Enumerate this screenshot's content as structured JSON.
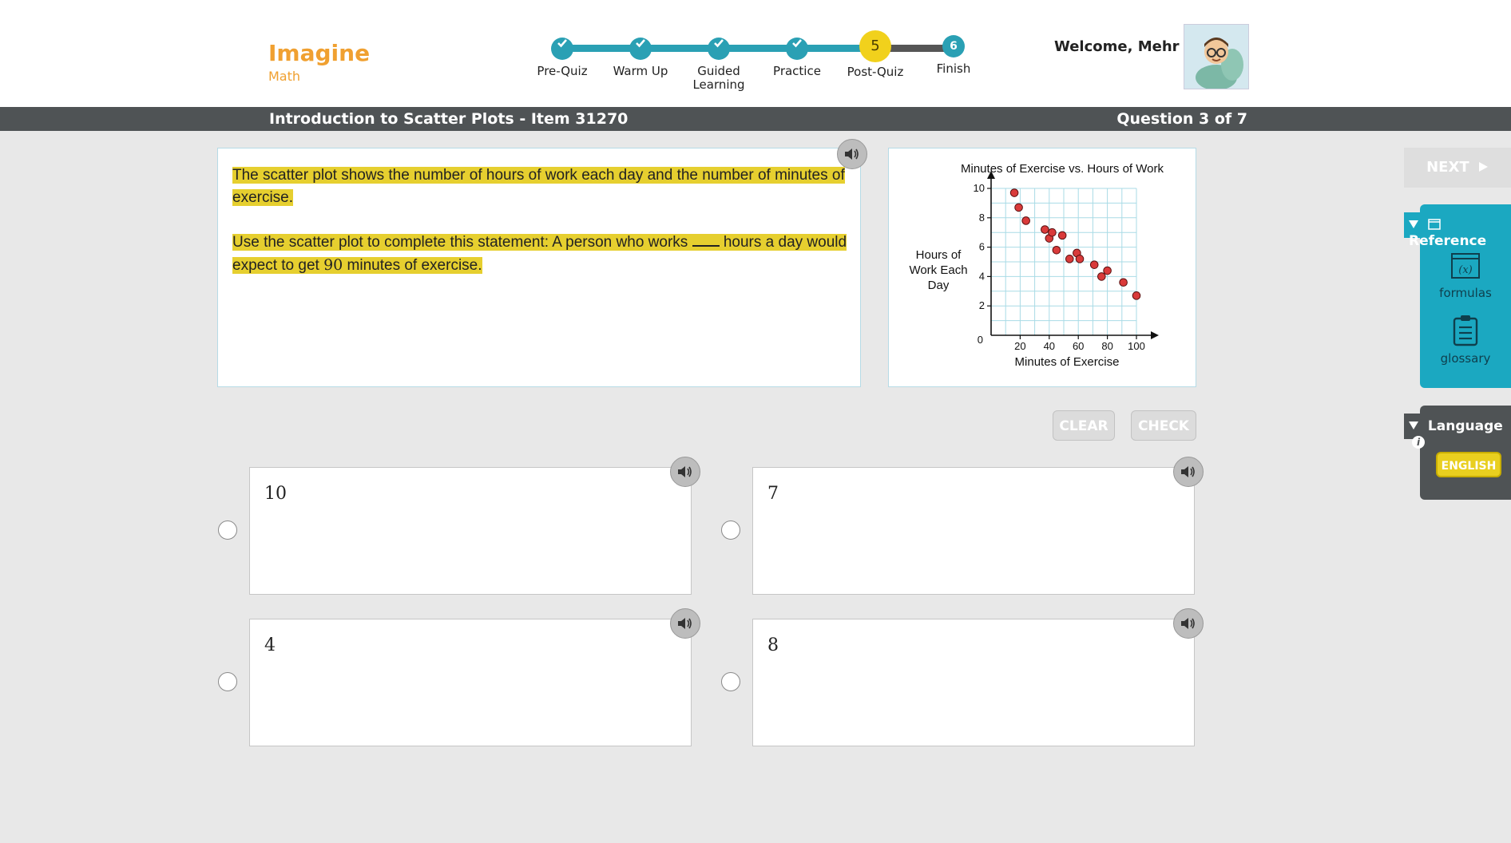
{
  "header": {
    "logo_main": "Imagine",
    "logo_sub": "Math",
    "steps": [
      {
        "label": "Pre-Quiz",
        "state": "done"
      },
      {
        "label": "Warm Up",
        "state": "done"
      },
      {
        "label": "Guided Learning",
        "state": "done"
      },
      {
        "label": "Practice",
        "state": "done"
      },
      {
        "label": "Post-Quiz",
        "state": "current",
        "number": "5"
      },
      {
        "label": "Finish",
        "state": "todo",
        "number": "6"
      }
    ],
    "welcome": "Welcome, Mehr"
  },
  "titlebar": {
    "title": "Introduction to Scatter Plots - Item 31270",
    "question_count": "Question 3 of 7"
  },
  "prompt": {
    "paragraph1": "The scatter plot shows the number of hours of work each day and the number of minutes of exercise.",
    "paragraph2_before": "Use the scatter plot to complete this statement: A person who works",
    "paragraph2_mid": "hours a day would expect to get",
    "paragraph2_value": "90",
    "paragraph2_after": "minutes of exercise."
  },
  "chart_data": {
    "type": "scatter",
    "title": "Minutes of Exercise vs. Hours of Work",
    "xlabel": "Minutes of Exercise",
    "ylabel": "Hours of Work Each Day",
    "xlim": [
      0,
      100
    ],
    "ylim": [
      0,
      10
    ],
    "x_ticks": [
      20,
      40,
      60,
      80,
      100
    ],
    "y_ticks": [
      2,
      4,
      6,
      8,
      10
    ],
    "origin_label": "0",
    "grid": true,
    "point_color": "#d93a3a",
    "points": [
      [
        16,
        9.7
      ],
      [
        19,
        8.7
      ],
      [
        24,
        7.8
      ],
      [
        37,
        7.2
      ],
      [
        40,
        6.6
      ],
      [
        42,
        7.0
      ],
      [
        45,
        5.8
      ],
      [
        49,
        6.8
      ],
      [
        54,
        5.2
      ],
      [
        59,
        5.6
      ],
      [
        61,
        5.2
      ],
      [
        71,
        4.8
      ],
      [
        76,
        4.0
      ],
      [
        80,
        4.4
      ],
      [
        91,
        3.6
      ],
      [
        100,
        2.7
      ]
    ]
  },
  "controls": {
    "clear_label": "CLEAR",
    "check_label": "CHECK"
  },
  "choices": [
    {
      "value": "10"
    },
    {
      "value": "7"
    },
    {
      "value": "4"
    },
    {
      "value": "8"
    }
  ],
  "sidebar": {
    "next_label": "NEXT",
    "reference_label": "Reference",
    "formulas_label": "formulas",
    "glossary_label": "glossary",
    "language_label": "Language",
    "english_label": "ENGLISH"
  },
  "colors": {
    "accent_teal": "#2aa0b4",
    "current_step_yellow": "#f1d11c",
    "highlight_yellow": "#e6cf2f",
    "reference_panel": "#1ba8c1",
    "dark_bar": "#4f5355"
  }
}
